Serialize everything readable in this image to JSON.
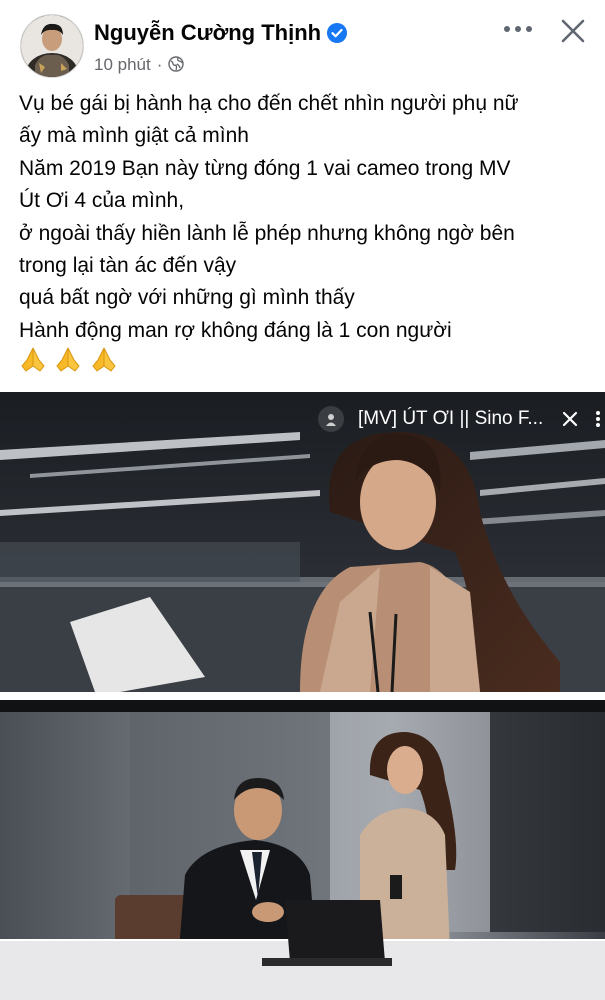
{
  "post": {
    "author": "Nguyễn Cường Thịnh",
    "verified": true,
    "time": "10 phút",
    "separator": "·",
    "privacy_icon": "globe-icon",
    "more_icon": "more-horizontal-icon",
    "close_icon": "close-icon",
    "lines": [
      "Vụ bé gái bị hành hạ cho đến chết nhìn người phụ nữ",
      "ấy mà mình giật cả mình",
      "Năm 2019 Bạn này từng đóng 1 vai cameo trong MV",
      "Út Ơi 4 của mình,",
      "ở ngoài thấy hiền lành lễ phép nhưng không ngờ bên",
      "trong lại tàn ác đến vậy",
      "quá bất ngờ với những gì mình thấy",
      "Hành động man rợ không đáng là 1 con người"
    ],
    "emoji": [
      "🙏",
      "🙏",
      "🙏"
    ]
  },
  "media": {
    "video": {
      "title": "[MV] ÚT ƠI || Sino F...",
      "channel_icon": "channel-avatar-icon",
      "close_icon": "close-icon"
    },
    "photo": {}
  },
  "colors": {
    "text": "#050505",
    "secondary": "#65676b",
    "verified": "#1877f2",
    "emoji": "#f7b928"
  }
}
